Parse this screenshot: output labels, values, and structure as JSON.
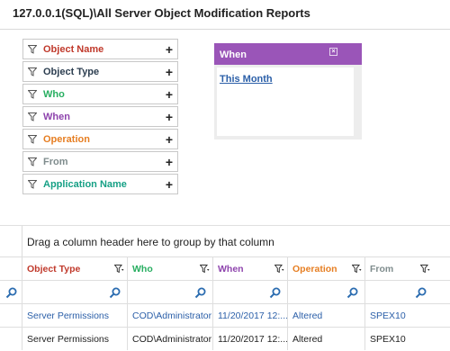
{
  "title": "127.0.0.1(SQL)\\All Server Object Modification Reports",
  "filters": [
    {
      "label": "Object Name",
      "color": "#c0392b"
    },
    {
      "label": "Object Type",
      "color": "#2c3e50"
    },
    {
      "label": "Who",
      "color": "#27ae60"
    },
    {
      "label": "When",
      "color": "#8e44ad"
    },
    {
      "label": "Operation",
      "color": "#e67e22"
    },
    {
      "label": "From",
      "color": "#7f8c8d"
    },
    {
      "label": "Application Name",
      "color": "#16a085"
    }
  ],
  "filter_add_glyph": "+",
  "when_panel": {
    "title": "When",
    "close_glyph": "×",
    "link": "This Month",
    "header_color": "#9a55b8"
  },
  "group_hint": "Drag a column header here to group by that column",
  "columns": [
    {
      "label": "Object Type",
      "color": "#c0392b"
    },
    {
      "label": "Who",
      "color": "#27ae60"
    },
    {
      "label": "When",
      "color": "#8e44ad"
    },
    {
      "label": "Operation",
      "color": "#e67e22"
    },
    {
      "label": "From",
      "color": "#7f8c8d"
    }
  ],
  "rows": [
    [
      "Server Permissions",
      "COD\\Administrator",
      "11/20/2017 12:...",
      "Altered",
      "SPEX10"
    ],
    [
      "Server Permissions",
      "COD\\Administrator",
      "11/20/2017 12:...",
      "Altered",
      "SPEX10"
    ]
  ]
}
